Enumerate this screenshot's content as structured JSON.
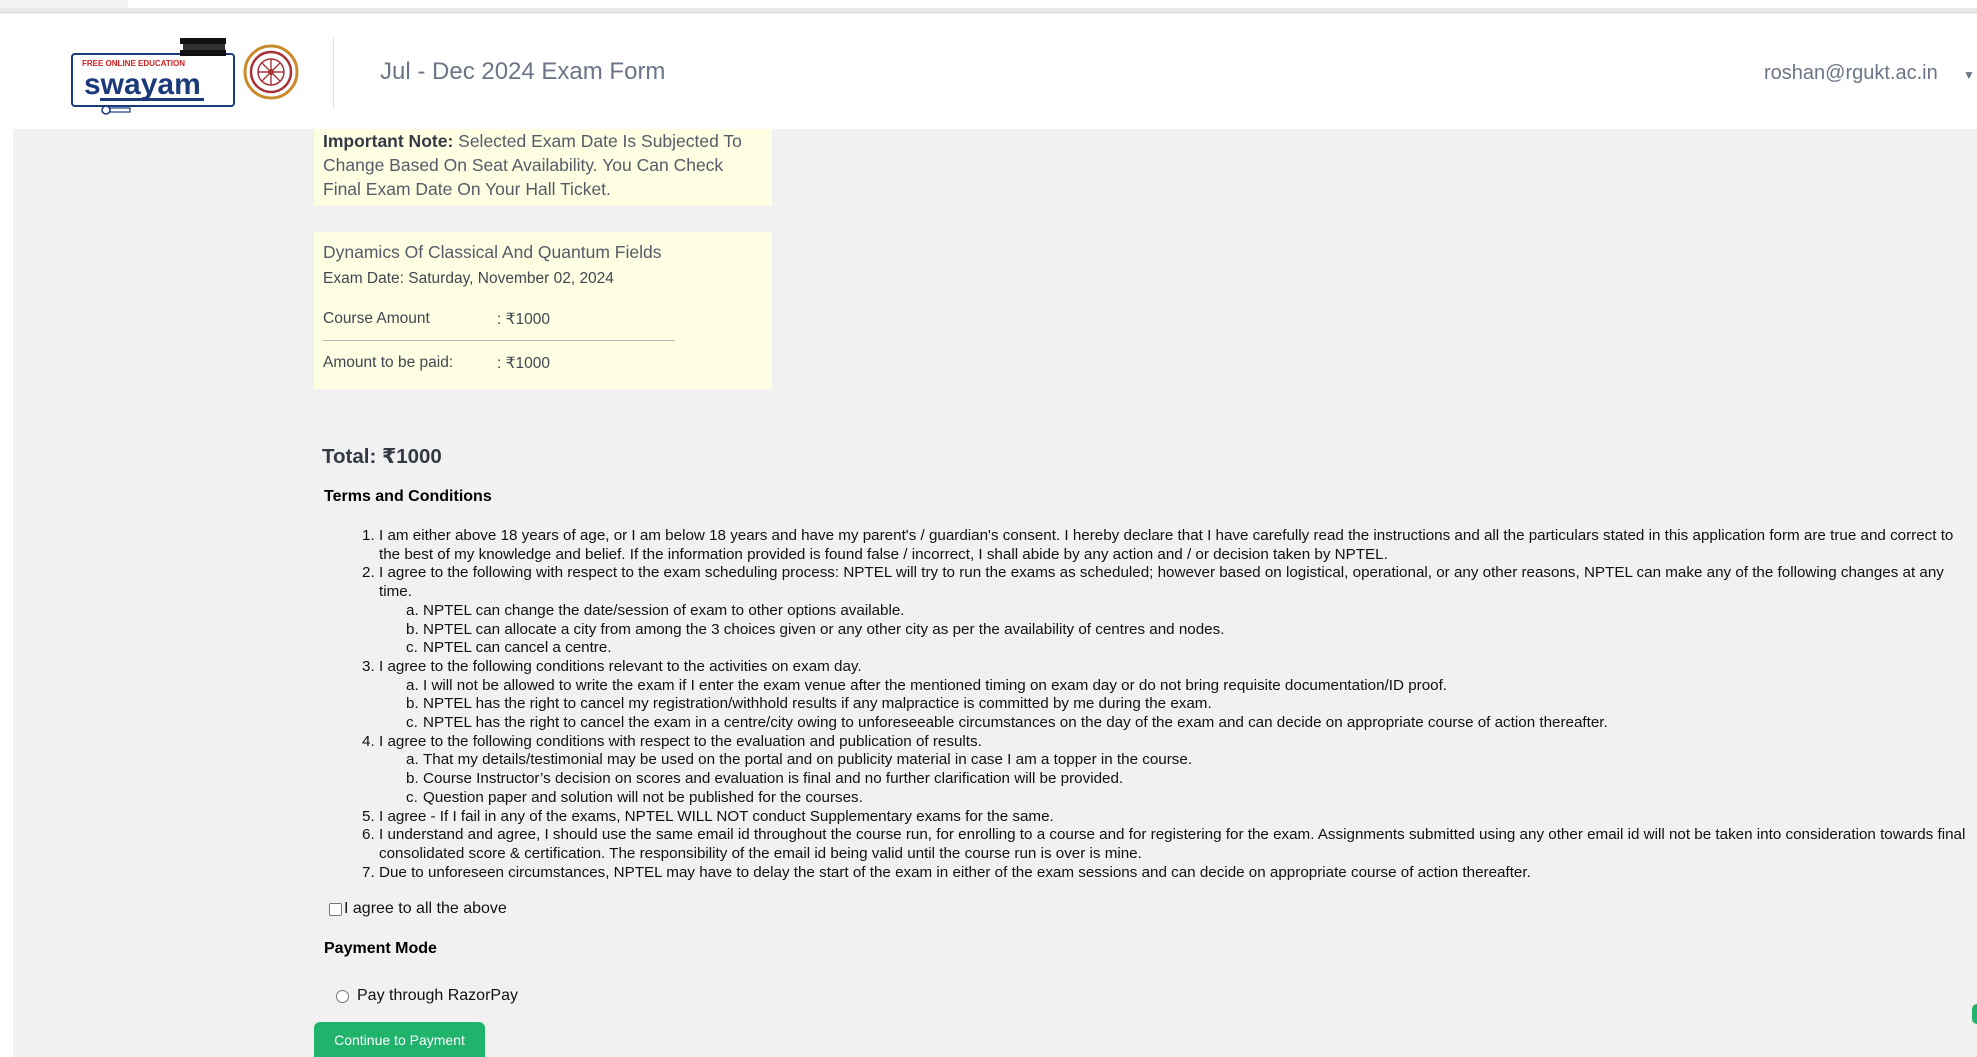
{
  "header": {
    "logo_text": "swayam",
    "logo_tagline": "FREE ONLINE EDUCATION",
    "title": "Jul - Dec 2024 Exam Form",
    "user_email": "roshan@rgukt.ac.in"
  },
  "note": {
    "label": "Important Note:",
    "text": "Selected Exam Date Is Subjected To Change Based On Seat Availability. You Can Check Final Exam Date On Your Hall Ticket."
  },
  "course": {
    "name": "Dynamics Of Classical And Quantum Fields",
    "exam_date": "Exam Date: Saturday, November 02, 2024",
    "amount_label": "Course Amount",
    "amount_value": ": ₹1000",
    "to_pay_label": "Amount to be paid:",
    "to_pay_value": ": ₹1000"
  },
  "total": "Total: ₹1000",
  "terms": {
    "heading": "Terms and Conditions",
    "items": [
      {
        "num": "1.",
        "text": "I am either above 18 years of age, or I am below 18 years and have my parent's / guardian's consent. I hereby declare that I have carefully read the instructions and all the particulars stated in this application form are true",
        "cont": "and correct to the best of my knowledge and belief. If the information provided is found false / incorrect, I shall abide by any action and / or decision taken by NPTEL."
      },
      {
        "num": "2.",
        "text": "I agree to the following with respect to the exam scheduling process: NPTEL will try to run the exams as scheduled; however based on logistical, operational, or any other reasons, NPTEL can make any of the following",
        "cont": "changes at any time.",
        "subs": [
          {
            "num": "a.",
            "text": "NPTEL can change the date/session of exam to other options available."
          },
          {
            "num": "b.",
            "text": "NPTEL can allocate a city from among the 3 choices given or any other city as per the availability of centres and nodes."
          },
          {
            "num": "c.",
            "text": "NPTEL can cancel a centre."
          }
        ]
      },
      {
        "num": "3.",
        "text": "I agree to the following conditions relevant to the activities on exam day.",
        "subs": [
          {
            "num": "a.",
            "text": "I will not be allowed to write the exam if I enter the exam venue after the mentioned timing on exam day or do not bring requisite documentation/ID proof."
          },
          {
            "num": "b.",
            "text": "NPTEL has the right to cancel my registration/withhold results if any malpractice is committed by me during the exam."
          },
          {
            "num": "c.",
            "text": "NPTEL has the right to cancel the exam in a centre/city owing to unforeseeable circumstances on the day of the exam and can decide on appropriate course of action thereafter."
          }
        ]
      },
      {
        "num": "4.",
        "text": "I agree to the following conditions with respect to the evaluation and publication of results.",
        "subs": [
          {
            "num": "a.",
            "text": "That my details/testimonial may be used on the portal and on publicity material in case I am a topper in the course."
          },
          {
            "num": "b.",
            "text": "Course Instructor’s decision on scores and evaluation is final and no further clarification will be provided."
          },
          {
            "num": "c.",
            "text": "Question paper and solution will not be published for the courses."
          }
        ]
      },
      {
        "num": "5.",
        "text": "I agree - If I fail in any of the exams, NPTEL WILL NOT conduct Supplementary exams for the same."
      },
      {
        "num": "6.",
        "text": "I understand and agree, I should use the same email id throughout the course run, for enrolling to a course and for registering for the exam. Assignments submitted using any other email id will not be taken into",
        "cont": "consideration towards final consolidated score & certification. The responsibility of the email id being valid until the course run is over is mine."
      },
      {
        "num": "7.",
        "text": "Due to unforeseen circumstances, NPTEL may have to delay the start of the exam in either of the exam sessions and can decide on appropriate course of action thereafter."
      }
    ]
  },
  "agree_label": "I agree to all the above",
  "payment": {
    "heading": "Payment Mode",
    "option": "Pay through RazorPay",
    "button": "Continue to Payment"
  }
}
